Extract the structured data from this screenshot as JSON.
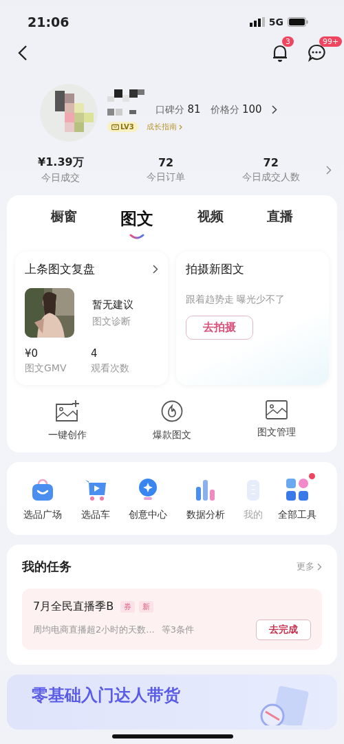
{
  "status_bar": {
    "time": "21:06",
    "network": "5G"
  },
  "nav": {
    "notification_badge": "3",
    "message_badge": "99+"
  },
  "profile": {
    "scores": [
      {
        "label": "口碑分",
        "value": "81"
      },
      {
        "label": "价格分",
        "value": "100"
      }
    ],
    "level": "LV3",
    "guide_link": "成长指南"
  },
  "stats": [
    {
      "value": "¥1.39万",
      "label": "今日成交"
    },
    {
      "value": "72",
      "label": "今日订单"
    },
    {
      "value": "72",
      "label": "今日成交人数"
    }
  ],
  "tabs": [
    {
      "label": "橱窗",
      "selected": false
    },
    {
      "label": "图文",
      "selected": true
    },
    {
      "label": "视频",
      "selected": false
    },
    {
      "label": "直播",
      "selected": false
    }
  ],
  "review_card": {
    "title": "上条图文复盘",
    "suggestion": "暂无建议",
    "diagnosis": "图文诊断",
    "metrics": [
      {
        "value": "¥0",
        "label": "图文GMV"
      },
      {
        "value": "4",
        "label": "观看次数"
      }
    ]
  },
  "shoot_card": {
    "title": "拍摄新图文",
    "subtitle": "跟着趋势走 曝光少不了",
    "button": "去拍摄"
  },
  "quick_actions": [
    {
      "kind": "create",
      "label": "一键创作"
    },
    {
      "kind": "hot",
      "label": "爆款图文"
    },
    {
      "kind": "manage",
      "label": "图文管理"
    }
  ],
  "tools": [
    {
      "kind": "bag",
      "label": "选品广场",
      "dot": false,
      "faded": false
    },
    {
      "kind": "cart",
      "label": "选品车",
      "dot": false,
      "faded": false
    },
    {
      "kind": "bulb",
      "label": "创意中心",
      "dot": false,
      "faded": false
    },
    {
      "kind": "chart",
      "label": "数据分析",
      "dot": false,
      "faded": false
    },
    {
      "kind": "doc",
      "label": "我的",
      "dot": false,
      "faded": true
    },
    {
      "kind": "grid",
      "label": "全部工具",
      "dot": true,
      "faded": false
    }
  ],
  "tasks": {
    "title": "我的任务",
    "more": "更多",
    "items": [
      {
        "title": "7月全民直播季B",
        "tags": [
          "券",
          "新"
        ],
        "description": "周均电商直播超2小时的天数...",
        "conditions": "等3条件",
        "button": "去完成"
      }
    ]
  },
  "banner": {
    "title": "零基础入门达人带货"
  }
}
